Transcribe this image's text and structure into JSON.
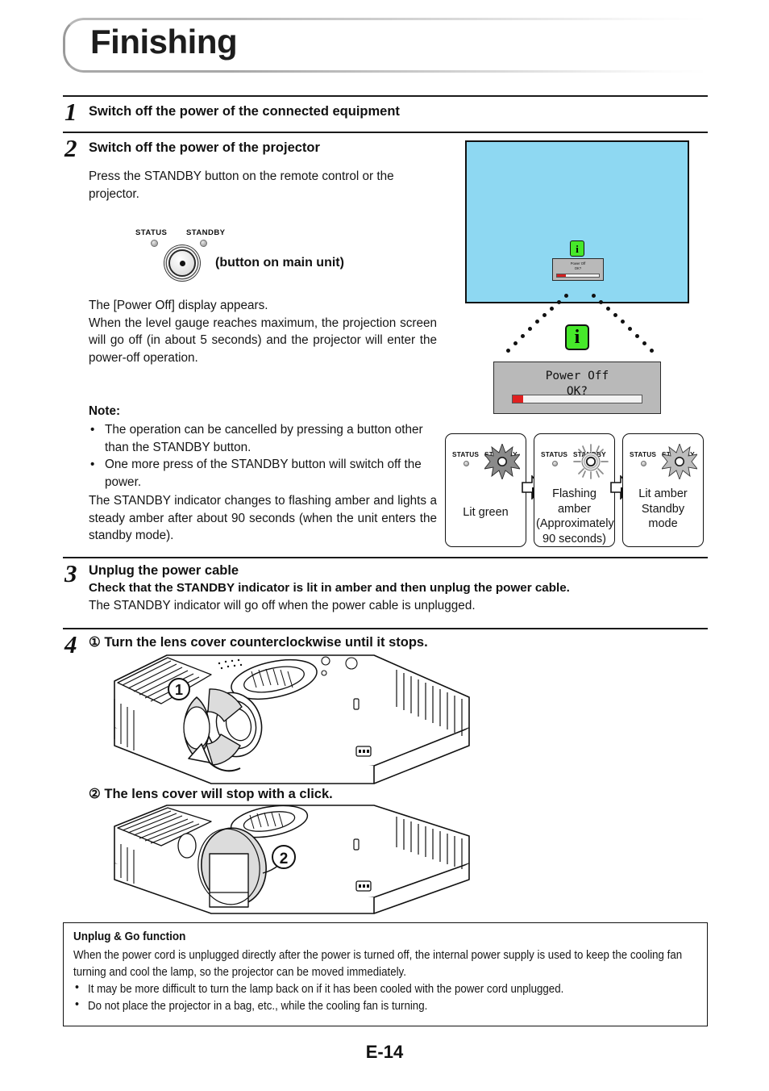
{
  "page": {
    "title": "Finishing",
    "footer": "E-14"
  },
  "steps": [
    {
      "number": "1",
      "heading": "Switch off the power of the connected equipment"
    },
    {
      "number": "2",
      "heading": "Switch off the power of the projector",
      "intro": "Press the STANDBY button on the remote control or the projector.",
      "indicator_panel": {
        "status_label": "STATUS",
        "standby_label": "STANDBY",
        "button_caption": "(button on main unit)"
      },
      "paragraph1": "The [Power Off] display appears.\nWhen the level gauge reaches maximum, the projection screen will go off (in about 5 seconds) and the projector will enter the power-off operation.",
      "note_title": "Note:",
      "notes": [
        "The operation can be cancelled by pressing a button other than the STANDBY button.",
        "One more press of the STANDBY button will switch off the power."
      ],
      "paragraph2": "The STANDBY indicator changes to flashing amber and lights a steady amber after about 90 seconds (when the unit enters the standby mode)."
    },
    {
      "number": "3",
      "heading": "Unplug the power cable",
      "bold_line": "Check that the STANDBY indicator is lit in amber and then unplug the power cable.",
      "plain_line": "The STANDBY indicator will go off when the power cable is unplugged."
    },
    {
      "number": "4",
      "substep1": "① Turn the lens cover counterclockwise until it stops.",
      "substep2": "② The lens cover will stop with a click.",
      "callout1": "1",
      "callout2": "2"
    }
  ],
  "projection_screen": {
    "dialog_title": "Power Off",
    "dialog_prompt": "OK?",
    "gauge_fill_percent": 8,
    "info_icon_glyph": "i",
    "screen_color": "#8ed8f2",
    "dialog_bg": "#b9b9b9",
    "gauge_color": "#e02020",
    "info_icon_color": "#46e82a"
  },
  "indicator_sequence": [
    {
      "status_label": "STATUS",
      "standby_label": "STANDBY",
      "caption": "Lit green",
      "state": "lit-dark"
    },
    {
      "status_label": "STATUS",
      "standby_label": "STANDBY",
      "caption": "Flashing amber\n(Approximately\n90 seconds)",
      "state": "flashing"
    },
    {
      "status_label": "STATUS",
      "standby_label": "STANDBY",
      "caption": "Lit amber\nStandby\nmode",
      "state": "lit-light"
    }
  ],
  "unplug_go_box": {
    "title": "Unplug & Go function",
    "paragraph": "When the power cord is unplugged directly after the power is turned off, the internal power supply is used to keep the cooling fan turning and cool the lamp, so the projector can be moved immediately.",
    "bullets": [
      "It may be more difficult to turn the lamp back on if it has been cooled with the power cord unplugged.",
      "Do not place the projector in a bag, etc., while the cooling fan is turning."
    ]
  }
}
